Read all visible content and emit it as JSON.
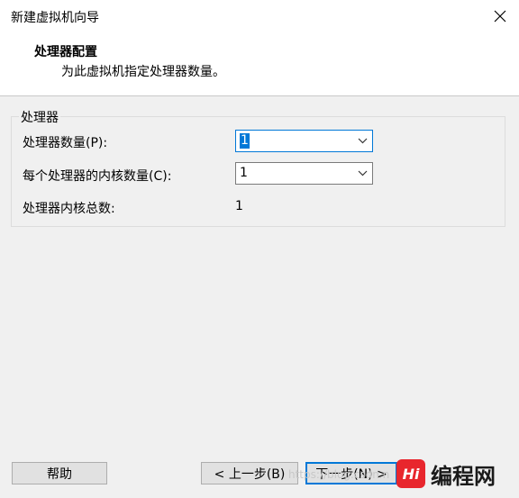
{
  "window": {
    "title": "新建虚拟机向导",
    "close_glyph": "✕"
  },
  "header": {
    "title": "处理器配置",
    "subtitle": "为此虚拟机指定处理器数量。"
  },
  "processor_group": {
    "legend": "处理器",
    "processor_count_label": "处理器数量(P):",
    "processor_count_value": "1",
    "cores_per_processor_label": "每个处理器的内核数量(C):",
    "cores_per_processor_value": "1",
    "total_cores_label": "处理器内核总数:",
    "total_cores_value": "1"
  },
  "footer": {
    "help_label": "帮助",
    "back_label": "< 上一步(B)",
    "next_label": "下一步(N) >"
  },
  "watermark": {
    "text": "https://blog.csdn.n"
  },
  "logo": {
    "mark": "Hi",
    "text": "编程网",
    "color": "#e8262d"
  },
  "colors": {
    "accent": "#0078d7",
    "background": "#f0f0f0"
  }
}
